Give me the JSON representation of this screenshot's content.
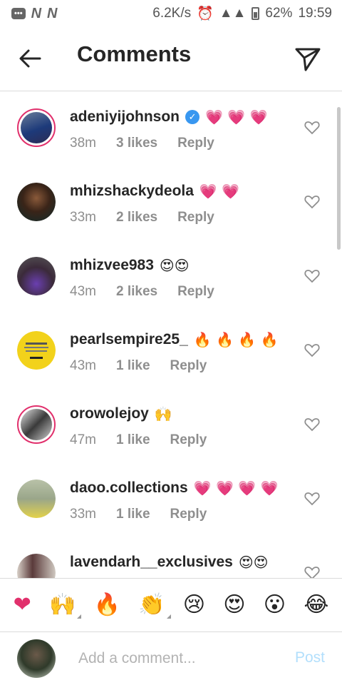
{
  "status_bar": {
    "speed": "6.2K/s",
    "battery": "62%",
    "time": "19:59"
  },
  "header": {
    "title": "Comments"
  },
  "comments": [
    {
      "username": "adeniyijohnson",
      "verified": true,
      "emojis": "💗 💗 💗",
      "time": "38m",
      "likes": "3 likes",
      "reply": "Reply"
    },
    {
      "username": "mhizshackydeola",
      "emojis": "💗 💗",
      "time": "33m",
      "likes": "2 likes",
      "reply": "Reply"
    },
    {
      "username": "mhizvee983",
      "emojis": "😍😍",
      "time": "43m",
      "likes": "2 likes",
      "reply": "Reply"
    },
    {
      "username": "pearlsempire25_",
      "emojis": "🔥 🔥 🔥 🔥",
      "time": "43m",
      "likes": "1 like",
      "reply": "Reply"
    },
    {
      "username": "orowolejoy",
      "emojis": "🙌",
      "time": "47m",
      "likes": "1 like",
      "reply": "Reply"
    },
    {
      "username": "daoo.collections",
      "emojis": "💗 💗 💗 💗",
      "time": "33m",
      "likes": "1 like",
      "reply": "Reply"
    },
    {
      "username": "lavendarh__exclusives",
      "emojis": "😍😍",
      "time": "",
      "likes": "",
      "reply": ""
    }
  ],
  "reactions": [
    "❤",
    "🙌",
    "🔥",
    "👏",
    "😢",
    "😍",
    "😮",
    "😂"
  ],
  "composer": {
    "placeholder": "Add a comment...",
    "post_label": "Post"
  },
  "colors": {
    "accent": "#3897f0",
    "post_disabled": "#b2dffc",
    "heart": "#e1306c"
  }
}
